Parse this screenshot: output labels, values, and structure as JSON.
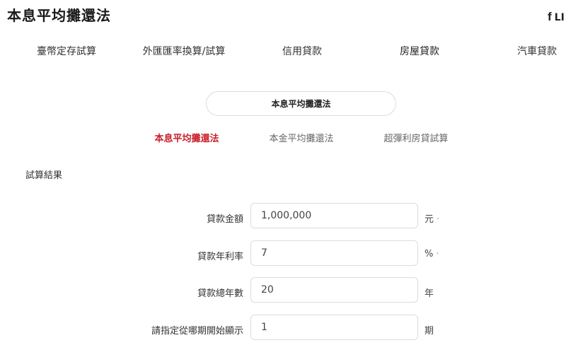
{
  "header": {
    "title": "本息平均攤還法",
    "share_label": "LI",
    "share_icon": "facebook-icon"
  },
  "nav": {
    "tabs": [
      {
        "label": "臺幣定存試算"
      },
      {
        "label": "外匯匯率換算/試算"
      },
      {
        "label": "信用貸款"
      },
      {
        "label": "房屋貸款"
      },
      {
        "label": "汽車貸款"
      }
    ],
    "active_index": 3
  },
  "calculator": {
    "selector_label": "本息平均攤還法",
    "sub_tabs": [
      {
        "label": "本息平均攤還法"
      },
      {
        "label": "本金平均攤還法"
      },
      {
        "label": "超彈利房貸試算"
      }
    ],
    "active_sub_index": 0,
    "accent_color": "#c8202a"
  },
  "results": {
    "section_title": "試算結果",
    "fields": [
      {
        "label": "貸款金額",
        "value": "1,000,000",
        "unit": "元",
        "unit_suffix": "·"
      },
      {
        "label": "貸款年利率",
        "value": "7",
        "unit": "%",
        "unit_suffix": "·"
      },
      {
        "label": "貸款總年數",
        "value": "20",
        "unit": "年",
        "unit_suffix": ""
      },
      {
        "label": "請指定從哪期開始顯示",
        "value": "1",
        "unit": "期",
        "unit_suffix": ""
      }
    ]
  }
}
